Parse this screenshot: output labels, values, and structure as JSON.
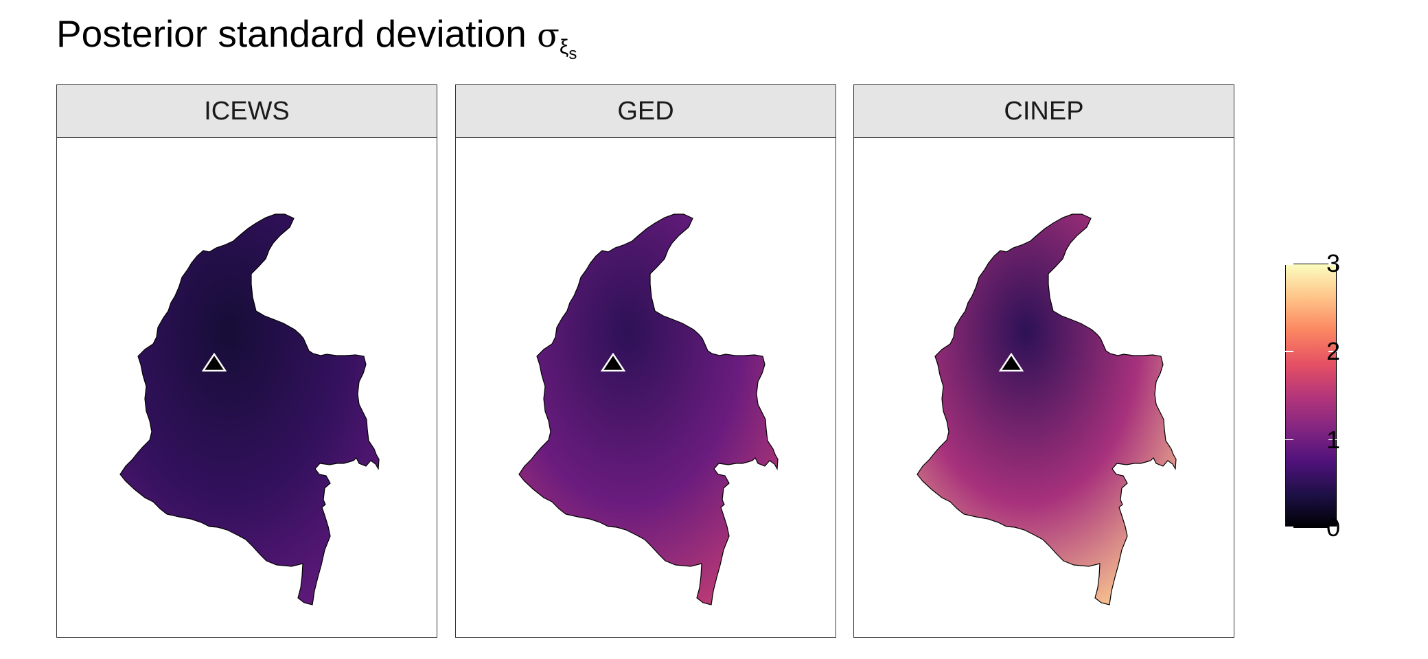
{
  "title": {
    "text": "Posterior standard deviation",
    "symbol": "σ",
    "sub": "ξ",
    "subsub": "s"
  },
  "chart_data": {
    "type": "heatmap",
    "title": "Posterior standard deviation σ_ξs",
    "panels": [
      {
        "name": "ICEWS",
        "fill_level": 0.55,
        "color_range": [
          0.3,
          0.9
        ]
      },
      {
        "name": "GED",
        "fill_level": 0.95,
        "color_range": [
          0.5,
          1.6
        ]
      },
      {
        "name": "CINEP",
        "fill_level": 1.4,
        "color_range": [
          0.5,
          2.7
        ]
      }
    ],
    "marker": "triangle",
    "colorbar": {
      "colormap": "magma",
      "range": [
        0,
        3
      ],
      "ticks": [
        0,
        1,
        2,
        3
      ],
      "tick_labels": [
        "0",
        "1",
        "2",
        "3"
      ]
    }
  }
}
